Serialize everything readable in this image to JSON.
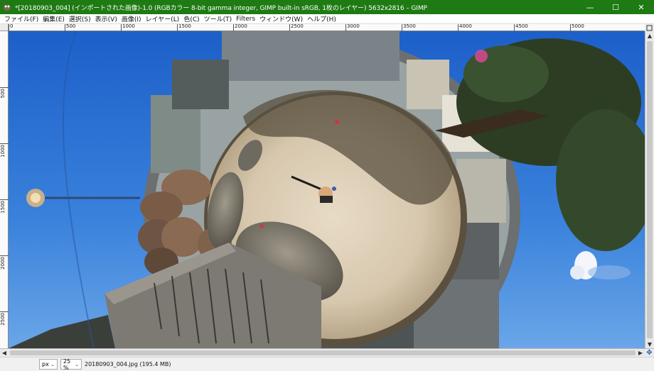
{
  "window": {
    "title": "*[20180903_004] (インポートされた画像)-1.0 (RGBカラー 8-bit gamma integer, GIMP built-in sRGB, 1枚のレイヤー) 5632x2816 – GIMP",
    "minimize_glyph": "—",
    "maximize_glyph": "☐",
    "close_glyph": "✕",
    "titlebar_color": "#1e7a12"
  },
  "menubar": {
    "items": [
      "ファイル(F)",
      "編集(E)",
      "選択(S)",
      "表示(V)",
      "画像(I)",
      "レイヤー(L)",
      "色(C)",
      "ツール(T)",
      "Filters",
      "ウィンドウ(W)",
      "ヘルプ(H)"
    ]
  },
  "rulers": {
    "top_labels": [
      "0",
      "500",
      "1000",
      "1500",
      "2000",
      "2500",
      "3000",
      "3500",
      "4000",
      "4500",
      "5000"
    ],
    "left_labels": [
      "500",
      "1000",
      "1500",
      "2000",
      "2500"
    ]
  },
  "statusbar": {
    "unit": "px",
    "zoom": "25 %",
    "file_info": "20180903_004.jpg (195.4 MB)"
  },
  "icons": {
    "app": "gimp-icon",
    "nav": "navigate-icon"
  }
}
